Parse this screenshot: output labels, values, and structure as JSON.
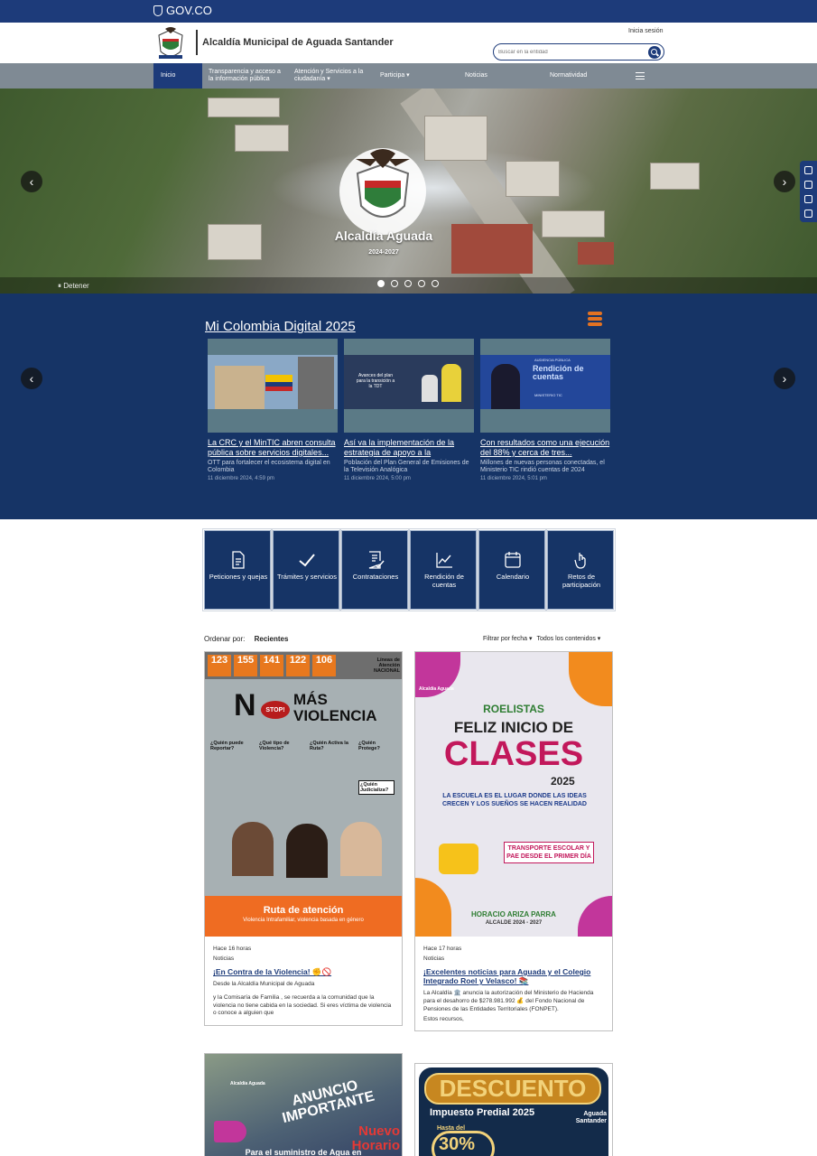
{
  "gov_bar": {
    "logo_text": "GOV.CO"
  },
  "header": {
    "site_title": "Alcaldía Municipal de Aguada Santander",
    "login_label": "Inicia sesión",
    "search_placeholder": "Buscar en la entidad"
  },
  "nav": {
    "items": [
      {
        "label": "Inicio",
        "active": true
      },
      {
        "label": "Transparencia y acceso a la información pública"
      },
      {
        "label": "Atención y Servicios a la ciudadanía ▾"
      },
      {
        "label": "Participa ▾"
      },
      {
        "label": "Noticias"
      },
      {
        "label": "Normatividad"
      }
    ]
  },
  "hero": {
    "title": "Alcaldía Aguada",
    "years": "2024-2027",
    "stop_label": "Detener",
    "slide_count": 5,
    "active_slide": 1
  },
  "digital": {
    "title": "Mi Colombia Digital 2025",
    "cards": [
      {
        "headline": "La CRC y el MinTIC abren consulta pública sobre servicios digitales...",
        "desc": "OTT para fortalecer el ecosistema digital en Colombia",
        "date": "11 diciembre 2024, 4:59 pm"
      },
      {
        "headline": "Así va la implementación de la estrategia de apoyo a la",
        "desc": "Población del Plan General de Emisiones de la Televisión Analógica",
        "date": "11 diciembre 2024, 5:00 pm",
        "img_text": "Avances del plan para la transición a la TDT"
      },
      {
        "headline": "Con resultados como una ejecución del 88% y cerca de tres...",
        "desc": "Millones de nuevas personas conectadas, el Ministerio TIC rindió cuentas de 2024",
        "date": "11 diciembre 2024, 5:01 pm",
        "img_small": "AUDIENCIA PÚBLICA",
        "img_title": "Rendición de cuentas",
        "img_sub": "MINISTERIO TIC"
      }
    ]
  },
  "quick_links": [
    {
      "label": "Peticiones y quejas",
      "icon": "document-icon"
    },
    {
      "label": "Trámites y servicios",
      "icon": "check-icon"
    },
    {
      "label": "Contrataciones",
      "icon": "contract-icon"
    },
    {
      "label": "Rendición de cuentas",
      "icon": "chart-icon"
    },
    {
      "label": "Calendario",
      "icon": "calendar-icon"
    },
    {
      "label": "Retos de participación",
      "icon": "hand-icon"
    }
  ],
  "filters": {
    "sort_label": "Ordenar por:",
    "sort_value": "Recientes",
    "date_filter": "Filtrar por fecha ▾",
    "content_filter": "Todos los contenidos ▾"
  },
  "posts": [
    {
      "time": "Hace 16 horas",
      "category": "Noticias",
      "title": "¡En Contra de la Violencia! ✊🚫",
      "body_1": "Desde la Alcaldía Municipal de Aguada",
      "body_2": "y la Comisaría de Familia , se recuerda a la comunidad que la violencia no tiene cabida en la sociedad. Si eres víctima de violencia o conoce a alguien que",
      "img": {
        "numbers": [
          "123",
          "155",
          "141",
          "122",
          "106"
        ],
        "lines_title": "Líneas de Atención NACIONAL",
        "n": "N",
        "stop": "STOP!",
        "headline": "MÁS VIOLENCIA",
        "q1": "¿Quién puede Reportar?",
        "q2": "¿Qué tipo de Violencia?",
        "q3": "¿Quién Activa la Ruta?",
        "q4": "¿Quién Protege?",
        "q5": "¿Quién Judicializa?",
        "footer_title": "Ruta de atención",
        "footer_sub": "Violencia Intrafamiliar, violencia basada en género"
      }
    },
    {
      "time": "Hace 17 horas",
      "category": "Noticias",
      "title": "¡Excelentes noticias para Aguada y el Colegio Integrado Roel y Velasco! 📚",
      "body_1": "La Alcaldía 🏛️ anuncia la autorización del Ministerio de Hacienda para el desahorro de $278.981.992 💰 del Fondo Nacional de Pensiones de las Entidades Territoriales (FONPET).",
      "body_2": "Estos recursos,",
      "img": {
        "brand": "Alcaldía Aguada",
        "l1": "ROELISTAS",
        "l2": "FELIZ INICIO DE",
        "l3": "CLASES",
        "l4": "2025",
        "l5": "LA ESCUELA ES EL LUGAR DONDE LAS IDEAS CRECEN Y LOS SUEÑOS SE HACEN REALIDAD",
        "l6": "TRANSPORTE ESCOLAR Y PAE DESDE EL PRIMER DÍA",
        "l7": "HORACIO ARIZA PARRA",
        "l8": "ALCALDE 2024 - 2027"
      }
    },
    {
      "img": {
        "brand": "Alcaldía Aguada",
        "l1": "ANUNCIO IMPORTANTE",
        "l2": "Nuevo Horario",
        "l3": "Para el suministro de Agua en"
      }
    },
    {
      "img": {
        "l1": "DESCUENTO",
        "l2": "Impuesto Predial 2025",
        "l3": "Aguada Santander",
        "l4": "Hasta del",
        "l5": "30%"
      }
    }
  ]
}
